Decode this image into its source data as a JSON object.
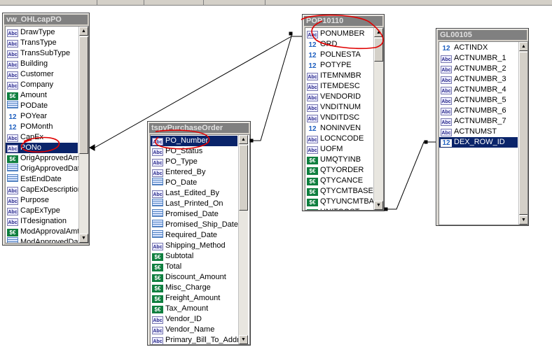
{
  "tables": {
    "ohlcap": {
      "title": "vw_OHLcapPO",
      "fields": [
        {
          "name": "DrawType",
          "type": "abc"
        },
        {
          "name": "TransType",
          "type": "abc"
        },
        {
          "name": "TransSubType",
          "type": "abc"
        },
        {
          "name": "Building",
          "type": "abc"
        },
        {
          "name": "Customer",
          "type": "abc"
        },
        {
          "name": "Company",
          "type": "abc"
        },
        {
          "name": "Amount",
          "type": "money"
        },
        {
          "name": "PODate",
          "type": "date"
        },
        {
          "name": "POYear",
          "type": "num"
        },
        {
          "name": "POMonth",
          "type": "num"
        },
        {
          "name": "CapEx",
          "type": "abc"
        },
        {
          "name": "PONo",
          "type": "abc",
          "selected": true
        },
        {
          "name": "OrigApprovedAmt",
          "type": "money"
        },
        {
          "name": "OrigApprovedDat",
          "type": "date"
        },
        {
          "name": "EstEndDate",
          "type": "date"
        },
        {
          "name": "CapExDescription",
          "type": "abc"
        },
        {
          "name": "Purpose",
          "type": "abc"
        },
        {
          "name": "CapExType",
          "type": "abc"
        },
        {
          "name": "ITdesignation",
          "type": "abc"
        },
        {
          "name": "ModApprovalAmt",
          "type": "money"
        },
        {
          "name": "ModApprovedDat",
          "type": "date"
        }
      ]
    },
    "tspv": {
      "title": "tspvPurchaseOrder",
      "fields": [
        {
          "name": "PO_Number",
          "type": "abc",
          "selected": true
        },
        {
          "name": "PO_Status",
          "type": "abc"
        },
        {
          "name": "PO_Type",
          "type": "abc"
        },
        {
          "name": "Entered_By",
          "type": "abc"
        },
        {
          "name": "PO_Date",
          "type": "date"
        },
        {
          "name": "Last_Edited_By",
          "type": "abc"
        },
        {
          "name": "Last_Printed_On",
          "type": "date"
        },
        {
          "name": "Promised_Date",
          "type": "date"
        },
        {
          "name": "Promised_Ship_Date",
          "type": "date"
        },
        {
          "name": "Required_Date",
          "type": "date"
        },
        {
          "name": "Shipping_Method",
          "type": "abc"
        },
        {
          "name": "Subtotal",
          "type": "money"
        },
        {
          "name": "Total",
          "type": "money"
        },
        {
          "name": "Discount_Amount",
          "type": "money"
        },
        {
          "name": "Misc_Charge",
          "type": "money"
        },
        {
          "name": "Freight_Amount",
          "type": "money"
        },
        {
          "name": "Tax_Amount",
          "type": "money"
        },
        {
          "name": "Vendor_ID",
          "type": "abc"
        },
        {
          "name": "Vendor_Name",
          "type": "abc"
        },
        {
          "name": "Primary_Bill_To_Addre",
          "type": "abc"
        }
      ]
    },
    "pop": {
      "title": "POP10110",
      "fields": [
        {
          "name": "PONUMBER",
          "type": "abc"
        },
        {
          "name": "ORD",
          "type": "num"
        },
        {
          "name": "POLNESTA",
          "type": "num"
        },
        {
          "name": "POTYPE",
          "type": "num"
        },
        {
          "name": "ITEMNMBR",
          "type": "abc"
        },
        {
          "name": "ITEMDESC",
          "type": "abc"
        },
        {
          "name": "VENDORID",
          "type": "abc"
        },
        {
          "name": "VNDITNUM",
          "type": "abc"
        },
        {
          "name": "VNDITDSC",
          "type": "abc"
        },
        {
          "name": "NONINVEN",
          "type": "num"
        },
        {
          "name": "LOCNCODE",
          "type": "abc"
        },
        {
          "name": "UOFM",
          "type": "abc"
        },
        {
          "name": "UMQTYINB",
          "type": "money"
        },
        {
          "name": "QTYORDER",
          "type": "money"
        },
        {
          "name": "QTYCANCE",
          "type": "money"
        },
        {
          "name": "QTYCMTBASE",
          "type": "money"
        },
        {
          "name": "QTYUNCMTBA",
          "type": "money"
        },
        {
          "name": "UNITCOST",
          "type": "money"
        }
      ]
    },
    "gl": {
      "title": "GL00105",
      "fields": [
        {
          "name": "ACTINDX",
          "type": "num"
        },
        {
          "name": "ACTNUMBR_1",
          "type": "abc"
        },
        {
          "name": "ACTNUMBR_2",
          "type": "abc"
        },
        {
          "name": "ACTNUMBR_3",
          "type": "abc"
        },
        {
          "name": "ACTNUMBR_4",
          "type": "abc"
        },
        {
          "name": "ACTNUMBR_5",
          "type": "abc"
        },
        {
          "name": "ACTNUMBR_6",
          "type": "abc"
        },
        {
          "name": "ACTNUMBR_7",
          "type": "abc"
        },
        {
          "name": "ACTNUMST",
          "type": "abc"
        },
        {
          "name": "DEX_ROW_ID",
          "type": "num",
          "selected": true
        }
      ]
    }
  },
  "icons": {
    "abc": "Abc",
    "num": "12",
    "money": "$€",
    "date": ""
  },
  "colors": {
    "selection": "#0a246a",
    "annotation": "#e00000",
    "titlebar": "#808080"
  }
}
